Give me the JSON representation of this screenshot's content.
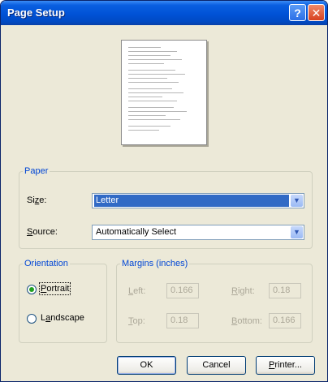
{
  "window": {
    "title": "Page Setup"
  },
  "titlebar": {
    "help": "?",
    "close": "✕"
  },
  "paper": {
    "legend": "Paper",
    "size_label_pre": "Si",
    "size_label_u": "z",
    "size_label_post": "e:",
    "size_value": "Letter",
    "source_label_u": "S",
    "source_label_post": "ource:",
    "source_value": "Automatically Select"
  },
  "orientation": {
    "legend": "Orientation",
    "portrait_u": "P",
    "portrait_post": "ortrait",
    "landscape_pre": "L",
    "landscape_u": "a",
    "landscape_post": "ndscape",
    "selected": "Portrait"
  },
  "margins": {
    "legend": "Margins (inches)",
    "left_u": "L",
    "left_post": "eft:",
    "left_value": "0.166",
    "right_u": "R",
    "right_post": "ight:",
    "right_value": "0.18",
    "top_u": "T",
    "top_post": "op:",
    "top_value": "0.18",
    "bottom_u": "B",
    "bottom_post": "ottom:",
    "bottom_value": "0.166"
  },
  "buttons": {
    "ok": "OK",
    "cancel": "Cancel",
    "printer_u": "P",
    "printer_post": "rinter..."
  },
  "icons": {
    "dropdown": "chevron-down-icon",
    "help": "help-icon",
    "close": "close-icon"
  }
}
